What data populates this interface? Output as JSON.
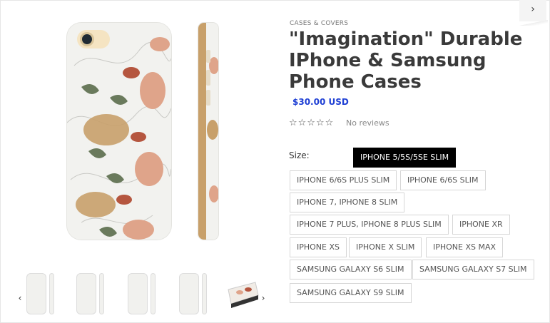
{
  "product": {
    "breadcrumb": "CASES & COVERS",
    "title": "\"Imagination\" Durable IPhone & Samsung Phone Cases",
    "price": "$30.00 USD",
    "rating_stars": "☆☆☆☆☆",
    "reviews": "No reviews"
  },
  "gallery": {
    "prev_icon": "chevron-left-icon",
    "next_icon": "chevron-right-icon",
    "prev_glyph": "‹",
    "next_glyph": "›"
  },
  "nav": {
    "next_product_glyph": "›"
  },
  "size": {
    "label": "Size:",
    "selected": "IPHONE 5/5S/5SE SLIM",
    "options": [
      "IPHONE 5/5S/5SE SLIM",
      "IPHONE 6/6S PLUS SLIM",
      "IPHONE 6/6S SLIM",
      "IPHONE 7, IPHONE 8 SLIM",
      "IPHONE 7 PLUS, IPHONE 8 PLUS SLIM",
      "IPHONE XR",
      "IPHONE XS",
      "IPHONE X SLIM",
      "IPHONE XS MAX",
      "SAMSUNG GALAXY S6 SLIM",
      "SAMSUNG GALAXY S7 SLIM",
      "SAMSUNG GALAXY S9 SLIM"
    ]
  },
  "colors": {
    "price": "#1e3fd4",
    "selected_bg": "#000000",
    "pattern_tan": "#c8a06a",
    "pattern_rust": "#b5563f",
    "pattern_pink": "#dfa48a",
    "pattern_green": "#6a7a5c"
  }
}
